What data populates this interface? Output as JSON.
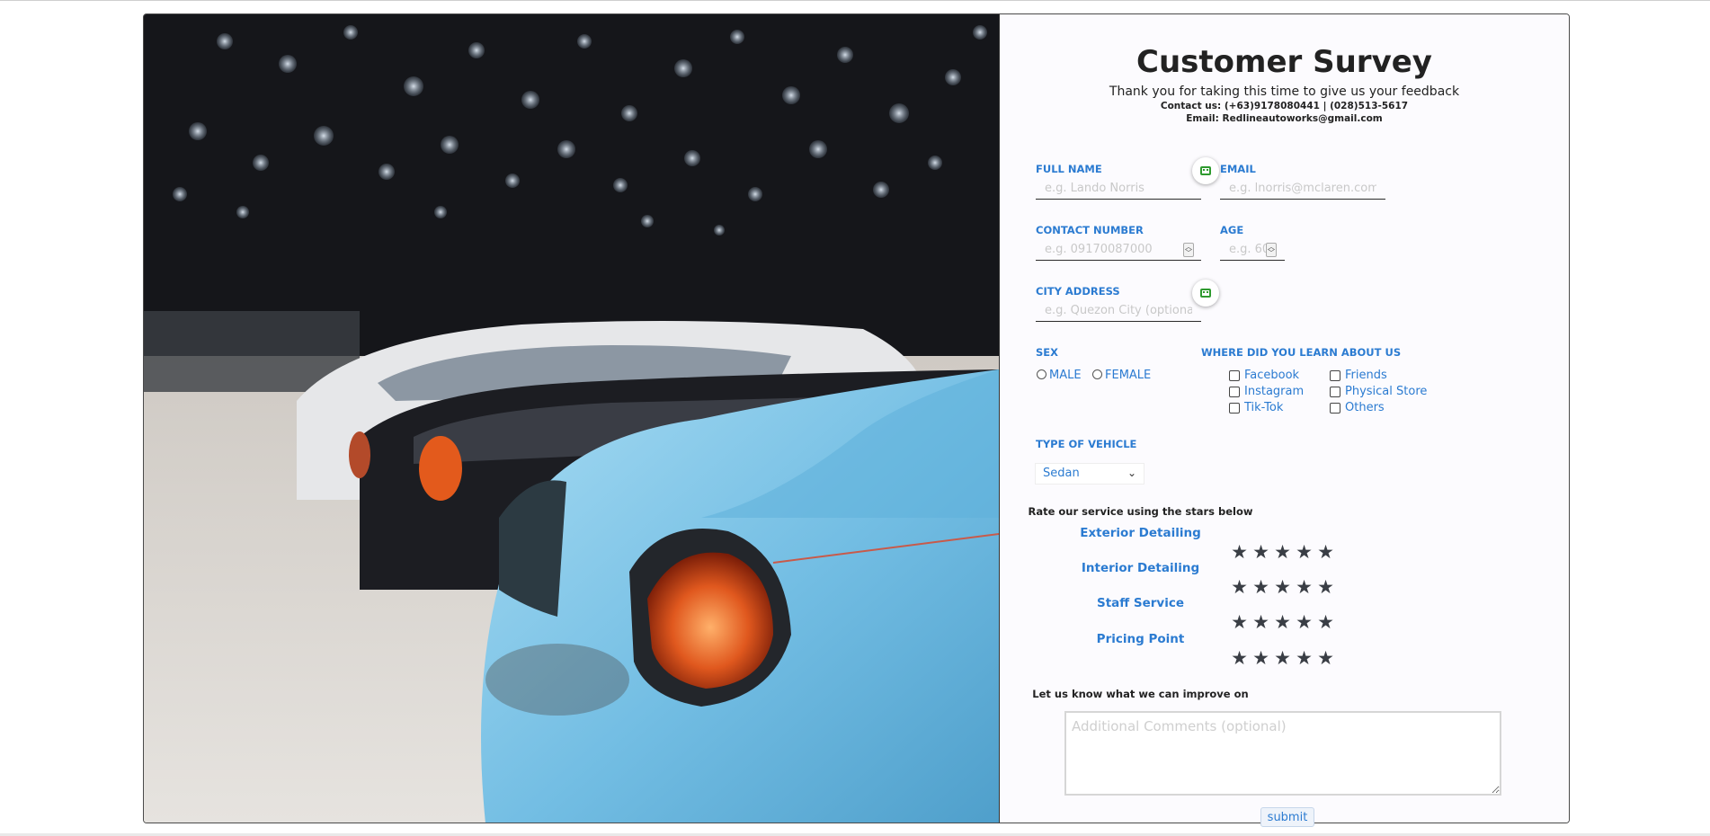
{
  "survey": {
    "title": "Customer Survey",
    "subtitle": "Thank you for taking this time to give us your feedback",
    "contact": "Contact us: (+63)9178080441 | (028)513-5617",
    "email": "Email: Redlineautoworks@gmail.com"
  },
  "fields": {
    "full_name": {
      "label": "FULL NAME",
      "placeholder": "e.g. Lando Norris"
    },
    "email": {
      "label": "EMAIL",
      "placeholder": "e.g. lnorris@mclaren.com"
    },
    "contact_number": {
      "label": "CONTACT NUMBER",
      "placeholder": "e.g. 09170087000"
    },
    "age": {
      "label": "AGE",
      "placeholder": "e.g. 60"
    },
    "city_address": {
      "label": "CITY ADDRESS",
      "placeholder": "e.g. Quezon City (optional)"
    }
  },
  "sex": {
    "label": "SEX",
    "options": [
      "MALE",
      "FEMALE"
    ]
  },
  "learn": {
    "label": "WHERE DID YOU LEARN ABOUT US",
    "options": [
      "Facebook",
      "Instagram",
      "Tik-Tok",
      "Friends",
      "Physical Store",
      "Others"
    ]
  },
  "vehicle": {
    "label": "TYPE OF VEHICLE",
    "selected": "Sedan"
  },
  "rating": {
    "header": "Rate our service using the stars below",
    "categories": [
      "Exterior Detailing",
      "Interior Detailing",
      "Staff Service",
      "Pricing Point"
    ],
    "star_glyph": "★"
  },
  "improve": {
    "header": "Let us know what we can improve on",
    "placeholder": "Additional Comments (optional)"
  },
  "submit_label": "submit",
  "icons": {
    "autofill": "autofill-extension-icon",
    "star": "star-icon",
    "chevron": "chevron-down-icon"
  },
  "colors": {
    "accent": "#2b7bd1",
    "star": "#3a3e45",
    "car": "#7ec3e6",
    "taillight": "#e0581e"
  }
}
